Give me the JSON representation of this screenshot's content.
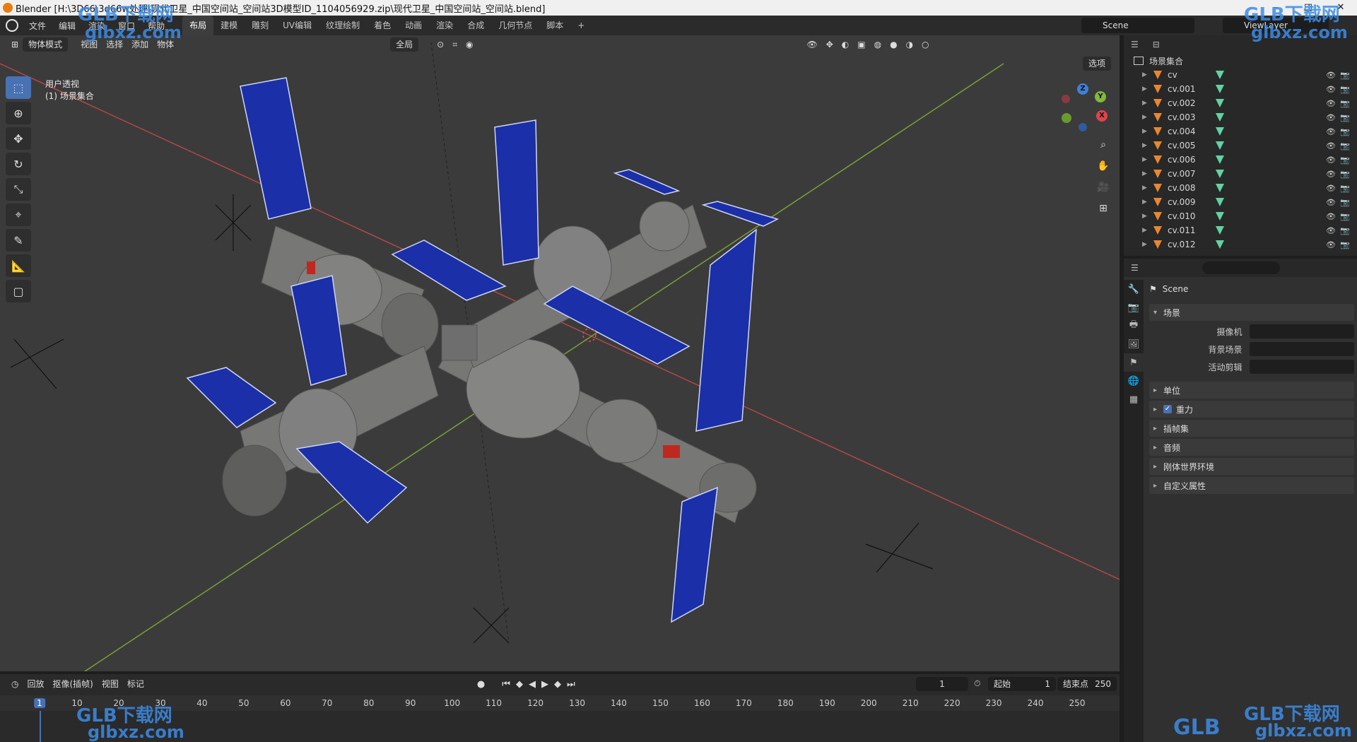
{
  "titlebar": {
    "title": "Blender [H:\\3D66\\3d66w处理\\现代卫星_中国空间站_空间站3D模型ID_1104056929.zip\\现代卫星_中国空间站_空间站.blend]",
    "min": "–",
    "max": "□",
    "close": "✕"
  },
  "menubar": {
    "menus": [
      "文件",
      "编辑",
      "渲染",
      "窗口",
      "帮助"
    ],
    "workspaces": [
      "布局",
      "建模",
      "雕刻",
      "UV编辑",
      "纹理绘制",
      "着色",
      "动画",
      "渲染",
      "合成",
      "几何节点",
      "脚本"
    ],
    "active_workspace": "布局",
    "add_tab": "+",
    "scene": "Scene",
    "view_layer": "ViewLayer"
  },
  "viewport": {
    "mode": "物体模式",
    "menus": [
      "视图",
      "选择",
      "添加",
      "物体"
    ],
    "transform_orientation": "全局",
    "options": "选项",
    "view_name": "用户透视",
    "collection_label": "(1) 场景集合",
    "axes": {
      "x": "X",
      "y": "Y",
      "z": "Z"
    },
    "colors": {
      "background": "#3b3b3b",
      "x_axis": "#c74444",
      "y_axis": "#7fa632",
      "panel_blue": "#1b2fa8",
      "hull": "#7a7a78"
    }
  },
  "outliner": {
    "root": "场景集合",
    "items": [
      "cv",
      "cv.001",
      "cv.002",
      "cv.003",
      "cv.004",
      "cv.005",
      "cv.006",
      "cv.007",
      "cv.008",
      "cv.009",
      "cv.010",
      "cv.011",
      "cv.012"
    ]
  },
  "properties": {
    "context": "Scene",
    "scene_panel": "场景",
    "fields": [
      {
        "label": "摄像机",
        "value": ""
      },
      {
        "label": "背景场景",
        "value": ""
      },
      {
        "label": "活动剪辑",
        "value": ""
      }
    ],
    "panels": [
      "单位",
      "重力",
      "插帧集",
      "音频",
      "刚体世界环境",
      "自定义属性"
    ],
    "gravity_checked": true
  },
  "timeline": {
    "menus": [
      "回放",
      "抠像(插帧)",
      "视图",
      "标记"
    ],
    "current_frame": "1",
    "start_label": "起始",
    "start": "1",
    "end_label": "结束点",
    "end": "250",
    "ticks": [
      "1",
      "10",
      "20",
      "30",
      "40",
      "50",
      "60",
      "70",
      "80",
      "90",
      "100",
      "110",
      "120",
      "130",
      "140",
      "150",
      "160",
      "170",
      "180",
      "190",
      "200",
      "210",
      "220",
      "230",
      "240",
      "250"
    ]
  },
  "watermark": {
    "brand": "GLB下载网",
    "url": "glbxz.com",
    "short": "GLB"
  }
}
